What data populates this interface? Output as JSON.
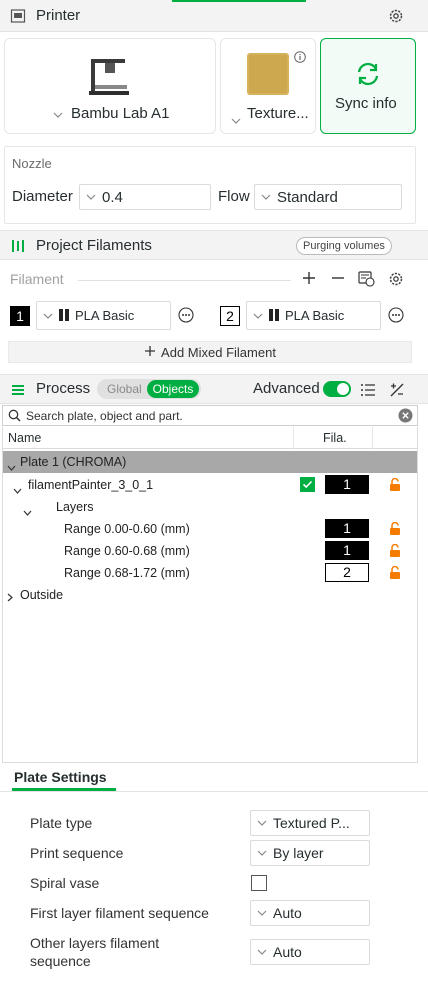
{
  "printer": {
    "title": "Printer",
    "printer_name": "Bambu Lab A1",
    "plate_name": "Texture...",
    "sync_label": "Sync info"
  },
  "nozzle": {
    "title": "Nozzle",
    "diameter_label": "Diameter",
    "diameter_value": "0.4",
    "flow_label": "Flow",
    "flow_value": "Standard"
  },
  "filaments": {
    "title": "Project Filaments",
    "purging_label": "Purging volumes",
    "filament_label": "Filament",
    "items": [
      {
        "index": "1",
        "name": "PLA Basic",
        "color": "#000000"
      },
      {
        "index": "2",
        "name": "PLA Basic",
        "color": "#ffffff"
      }
    ],
    "add_mixed_label": "Add Mixed Filament"
  },
  "process": {
    "title": "Process",
    "global_label": "Global",
    "objects_label": "Objects",
    "advanced_label": "Advanced",
    "advanced_on": true,
    "search_placeholder": "Search plate, object and part."
  },
  "tree": {
    "col_name": "Name",
    "col_fila": "Fila.",
    "plate_row": "Plate 1 (CHROMA)",
    "object_name": "filamentPainter_3_0_1",
    "object_fila": "1",
    "layers_label": "Layers",
    "ranges": [
      {
        "label": "Range 0.00-0.60 (mm)",
        "fila": "1",
        "dark": true
      },
      {
        "label": "Range 0.60-0.68 (mm)",
        "fila": "1",
        "dark": true
      },
      {
        "label": "Range 0.68-1.72 (mm)",
        "fila": "2",
        "dark": false
      }
    ],
    "outside_label": "Outside"
  },
  "plate_settings": {
    "tab_label": "Plate Settings",
    "plate_type_label": "Plate type",
    "plate_type_value": "Textured P...",
    "print_sequence_label": "Print sequence",
    "print_sequence_value": "By layer",
    "spiral_label": "Spiral vase",
    "spiral_checked": false,
    "first_layer_label": "First layer filament sequence",
    "first_layer_value": "Auto",
    "other_layers_label_1": "Other layers filament",
    "other_layers_label_2": "sequence",
    "other_layers_value": "Auto"
  },
  "colors": {
    "accent": "#00ae42",
    "header_bg": "#f3f3f3",
    "plate_row_bg": "#a8a8a8",
    "lock": "#f57c00"
  }
}
